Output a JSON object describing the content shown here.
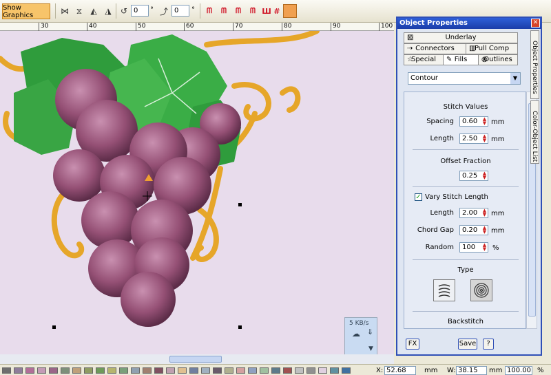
{
  "toolbar": {
    "show_graphics_label": "Show Graphics",
    "rotation_value": "0",
    "slant_value": "0",
    "degree_symbol": "°"
  },
  "ruler": {
    "ticks": [
      "30",
      "40",
      "50",
      "60",
      "70",
      "80",
      "90",
      "100"
    ]
  },
  "speed_widget": {
    "rate": "5 KB/s"
  },
  "status_bar": {
    "x_label": "X:",
    "x_value": "52.68",
    "x_unit": "mm",
    "w_label": "W:",
    "w_value": "38.15",
    "w_unit": "mm",
    "zoom_value": "100.00",
    "zoom_unit": "%",
    "palette": [
      "#6e6e6e",
      "#8f7d9a",
      "#b26e98",
      "#c49bb6",
      "#9a6688",
      "#7d8f7a",
      "#bfa07a",
      "#8f9c63",
      "#6e9a5a",
      "#b5b56e",
      "#7aa07a",
      "#90a0b0",
      "#a08070",
      "#805060",
      "#c0a0b0",
      "#e0c090",
      "#707f9f",
      "#a0b0c0",
      "#6a5a6a",
      "#b0b090",
      "#d4a0a0",
      "#8fa0c0",
      "#a0c0a0",
      "#5d7a8a",
      "#a05050",
      "#c0c0c0",
      "#909090",
      "#e0d0e0",
      "#6090a0",
      "#4070a0"
    ]
  },
  "panel": {
    "title": "Object Properties",
    "tabs": {
      "underlay": "Underlay",
      "connectors": "Connectors",
      "pull_comp": "Pull Comp",
      "special": "Special",
      "fills": "Fills",
      "outlines": "Outlines"
    },
    "fill_type": "Contour",
    "stitch_values": {
      "title": "Stitch Values",
      "spacing_label": "Spacing",
      "spacing_value": "0.60",
      "length_label": "Length",
      "length_value": "2.50",
      "unit": "mm"
    },
    "offset": {
      "title": "Offset Fraction",
      "value": "0.25"
    },
    "vary": {
      "checkbox_label": "Vary Stitch Length",
      "checked": true,
      "length_label": "Length",
      "length_value": "2.00",
      "chord_label": "Chord Gap",
      "chord_value": "0.20",
      "random_label": "Random",
      "random_value": "100",
      "mm": "mm",
      "percent": "%"
    },
    "type": {
      "title": "Type"
    },
    "backstitch_title": "Backstitch",
    "buttons": {
      "fx": "FX",
      "save": "Save",
      "help": "?"
    },
    "side_tabs": {
      "object_properties": "Object Properties",
      "color_object_list": "Color-Object List"
    }
  }
}
